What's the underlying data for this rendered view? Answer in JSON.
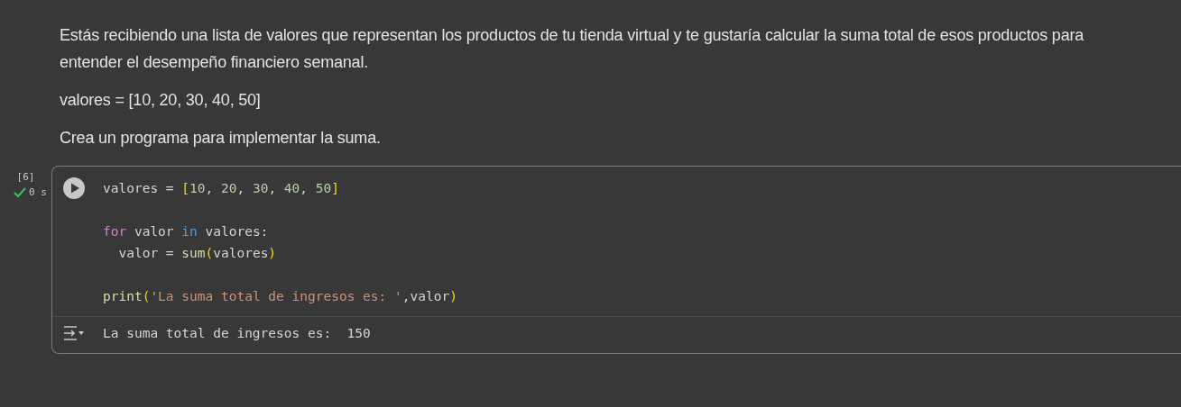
{
  "text_cell": {
    "paragraphs": [
      "Estás recibiendo una lista de valores que representan los productos de tu tienda virtual y te gustaría calcular la suma total de esos productos para entender el desempeño financiero semanal.",
      "valores = [10, 20, 30, 40, 50]",
      "Crea un programa para implementar la suma."
    ]
  },
  "code_cell": {
    "execution_count": "[6]",
    "status": {
      "succeeded": true,
      "duration": "0 s"
    },
    "code_blocks": [
      [
        [
          {
            "text": "valores = ",
            "kind": "plain"
          },
          {
            "text": "[",
            "kind": "bracket"
          },
          {
            "text": "10",
            "kind": "number"
          },
          {
            "text": ", ",
            "kind": "plain"
          },
          {
            "text": "20",
            "kind": "number"
          },
          {
            "text": ", ",
            "kind": "plain"
          },
          {
            "text": "30",
            "kind": "number"
          },
          {
            "text": ", ",
            "kind": "plain"
          },
          {
            "text": "40",
            "kind": "number"
          },
          {
            "text": ", ",
            "kind": "plain"
          },
          {
            "text": "50",
            "kind": "number"
          },
          {
            "text": "]",
            "kind": "bracket"
          }
        ]
      ],
      [
        [
          {
            "text": "for",
            "kind": "control"
          },
          {
            "text": " valor ",
            "kind": "plain"
          },
          {
            "text": "in",
            "kind": "keyword"
          },
          {
            "text": " valores:",
            "kind": "plain"
          }
        ],
        [
          {
            "text": "  valor = ",
            "kind": "plain"
          },
          {
            "text": "sum",
            "kind": "function"
          },
          {
            "text": "(",
            "kind": "bracket"
          },
          {
            "text": "valores",
            "kind": "plain"
          },
          {
            "text": ")",
            "kind": "bracket"
          }
        ]
      ],
      [
        [
          {
            "text": "print",
            "kind": "function"
          },
          {
            "text": "(",
            "kind": "bracket"
          },
          {
            "text": "'La suma total de ingresos es: '",
            "kind": "string"
          },
          {
            "text": ",valor",
            "kind": "plain"
          },
          {
            "text": ")",
            "kind": "bracket"
          }
        ]
      ]
    ],
    "output": "La suma total de ingresos es:  150"
  }
}
